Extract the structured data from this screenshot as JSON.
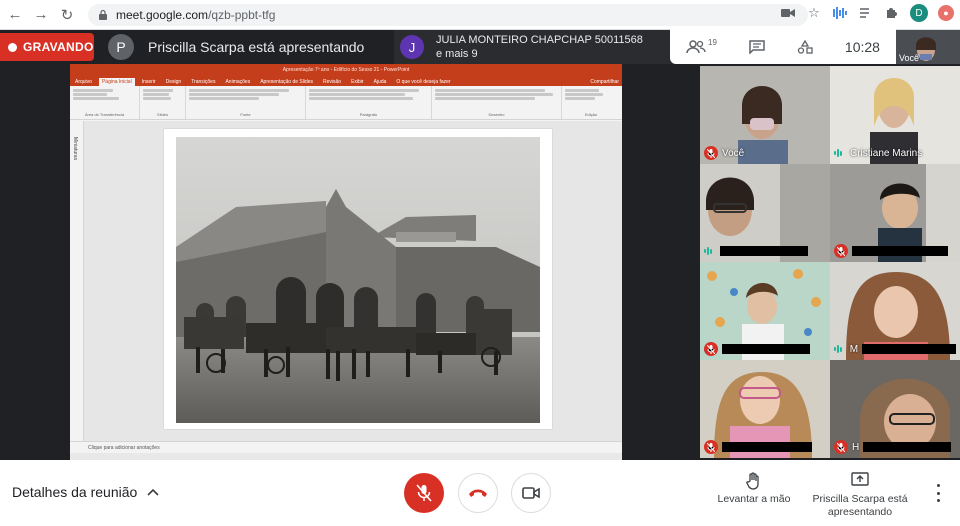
{
  "browser": {
    "url_host": "meet.google.com",
    "url_path": "/qzb-ppbt-tfg",
    "profile_initial": "D"
  },
  "meeting": {
    "recording_label": "GRAVANDO",
    "presenter_initial": "P",
    "presenter_text": "Priscilla Scarpa está apresentando",
    "joined_initial": "J",
    "joined_name": "JULIA MONTEIRO CHAPCHAP 50011568",
    "joined_more": "e mais 9",
    "participants_count": "19",
    "time": "10:28",
    "self_label": "Você"
  },
  "powerpoint": {
    "title": "Apresentação 7º ano - Edifício do Sesso 21 - PowerPoint",
    "tabs": [
      "Arquivo",
      "Página Inicial",
      "Inserir",
      "Design",
      "Transições",
      "Animações",
      "Apresentação de Slides",
      "Revisão",
      "Exibir",
      "Ajuda"
    ],
    "active_tab_index": 1,
    "search_hint": "O que você deseja fazer",
    "share_label": "Compartilhar",
    "ribbon_groups": [
      "Área de Transferência",
      "Slides",
      "Fonte",
      "Parágrafo",
      "Desenho",
      "Edição"
    ],
    "thumbnails_label": "Miniaturas",
    "notes_placeholder": "Clique para adicionar anotações"
  },
  "tiles": [
    {
      "name": "Você",
      "muted": true,
      "speaking": false,
      "redacted": false
    },
    {
      "name": "Cristiane Marins",
      "muted": false,
      "speaking": true,
      "redacted": false
    },
    {
      "name": "",
      "muted": false,
      "speaking": true,
      "redacted": true
    },
    {
      "name": "",
      "muted": true,
      "speaking": false,
      "redacted": true
    },
    {
      "name": "",
      "muted": true,
      "speaking": false,
      "redacted": true
    },
    {
      "name": "M",
      "muted": false,
      "speaking": true,
      "redacted": true
    },
    {
      "name": "",
      "muted": true,
      "speaking": false,
      "redacted": true
    },
    {
      "name": "H",
      "muted": true,
      "speaking": false,
      "redacted": true
    }
  ],
  "bottom_bar": {
    "details_label": "Detalhes da reunião",
    "raise_hand_label": "Levantar a mão",
    "presenting_label": "Priscilla Scarpa está apresentando"
  },
  "colors": {
    "record_red": "#d93025",
    "ppt_orange": "#c43e1c",
    "meet_dark": "#202124",
    "speaking_green": "#1fb89b"
  }
}
